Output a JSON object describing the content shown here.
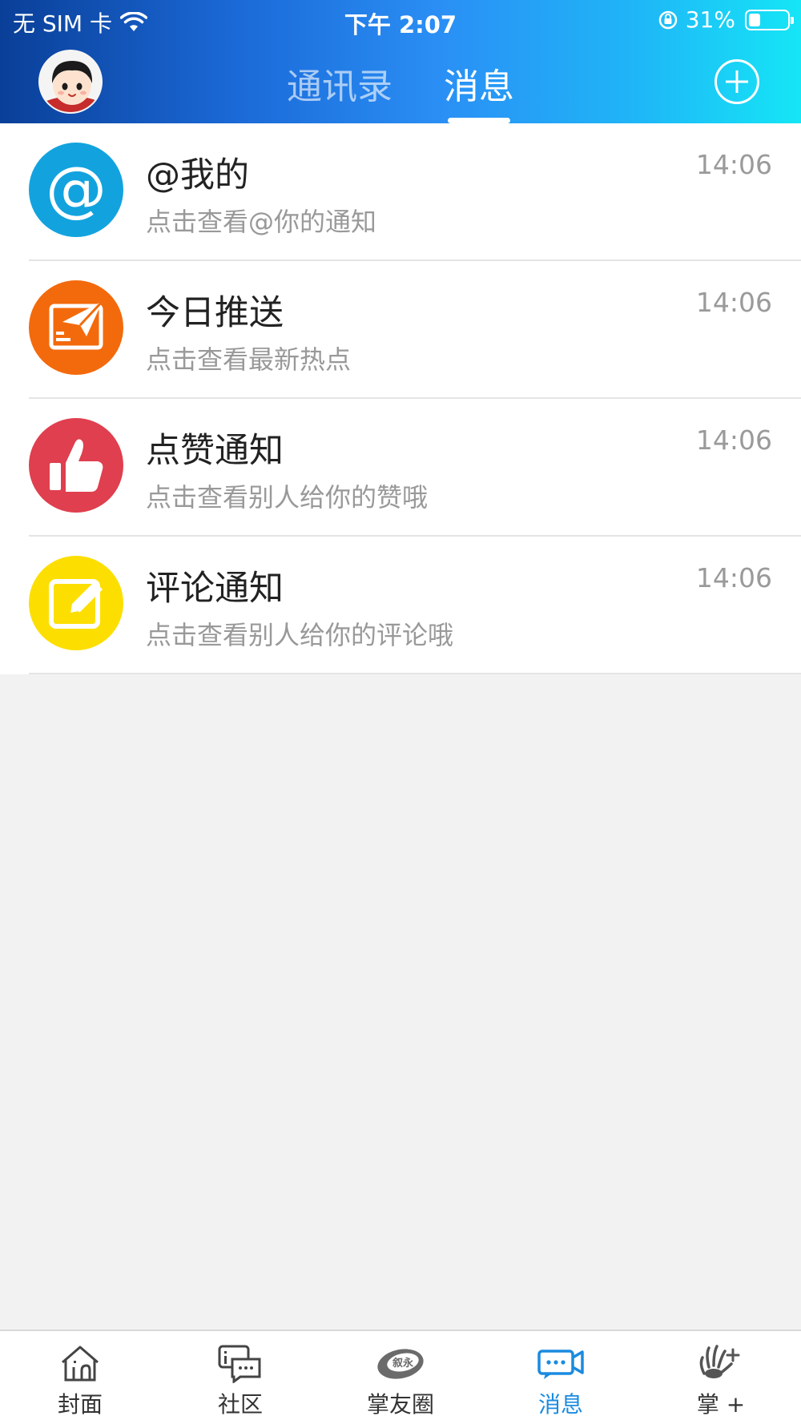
{
  "status_bar": {
    "carrier": "无 SIM 卡",
    "time": "下午 2:07",
    "battery": "31%",
    "battery_level": 0.31
  },
  "header": {
    "tabs": [
      {
        "label": "通讯录",
        "active": false
      },
      {
        "label": "消息",
        "active": true
      }
    ]
  },
  "messages": [
    {
      "title": "@我的",
      "subtitle": "点击查看@你的通知",
      "time": "14:06",
      "icon": "at-icon",
      "color": "#12a3df"
    },
    {
      "title": "今日推送",
      "subtitle": "点击查看最新热点",
      "time": "14:06",
      "icon": "paper-plane-icon",
      "color": "#f36a0c"
    },
    {
      "title": "点赞通知",
      "subtitle": "点击查看别人给你的赞哦",
      "time": "14:06",
      "icon": "thumbs-up-icon",
      "color": "#df3f4e"
    },
    {
      "title": "评论通知",
      "subtitle": "点击查看别人给你的评论哦",
      "time": "14:06",
      "icon": "edit-icon",
      "color": "#fcdf00"
    }
  ],
  "tabbar": {
    "items": [
      {
        "label": "封面",
        "icon": "home-icon",
        "active": false
      },
      {
        "label": "社区",
        "icon": "community-chat-icon",
        "active": false
      },
      {
        "label": "掌友圈",
        "icon": "friends-circle-logo-icon",
        "active": false
      },
      {
        "label": "消息",
        "icon": "message-video-icon",
        "active": true
      },
      {
        "label": "掌 +",
        "icon": "palm-plus-icon",
        "active": false
      }
    ],
    "active_color": "#1a8be0"
  }
}
